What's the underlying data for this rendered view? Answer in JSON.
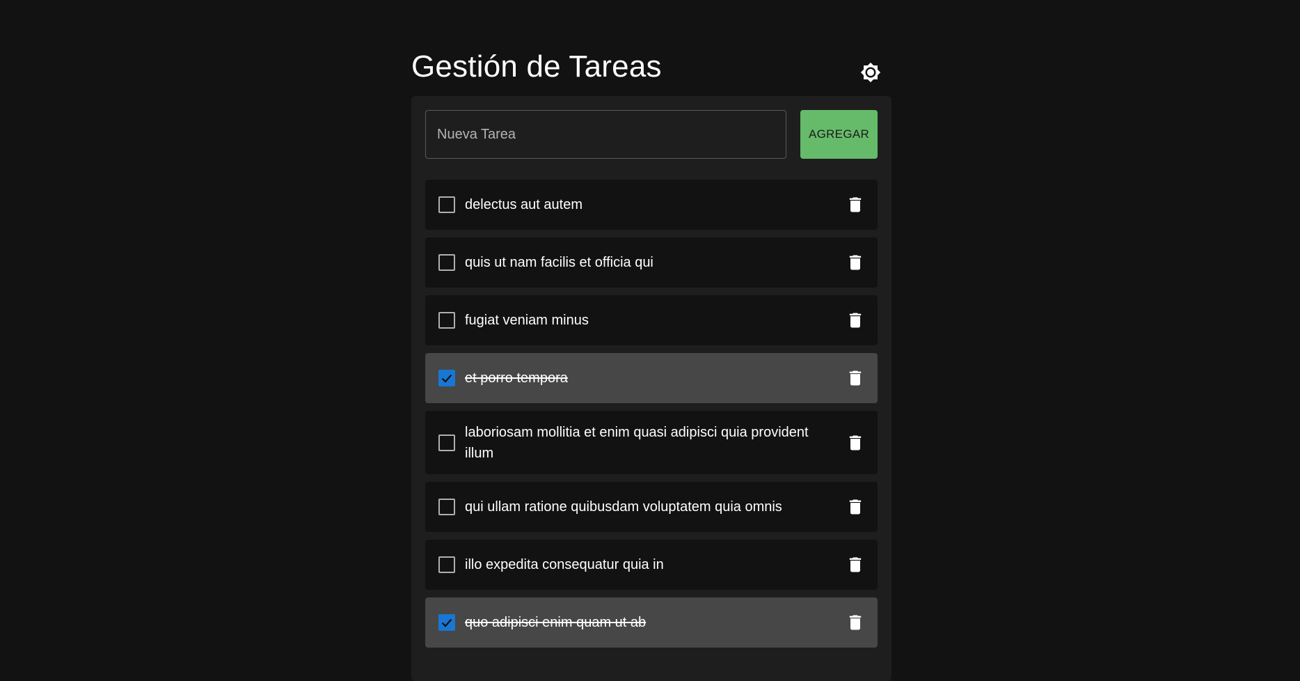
{
  "header": {
    "title": "Gestión de Tareas",
    "theme_icon": "brightness-icon"
  },
  "new_task": {
    "placeholder": "Nueva Tarea",
    "value": "",
    "add_label": "AGREGAR"
  },
  "colors": {
    "background": "#121212",
    "panel": "#1e1e1e",
    "task_item": "#121212",
    "task_item_done": "#474747",
    "accent_green": "#66bb6a",
    "checkbox_checked": "#1976d2"
  },
  "tasks": [
    {
      "text": "delectus aut autem",
      "completed": false
    },
    {
      "text": "quis ut nam facilis et officia qui",
      "completed": false
    },
    {
      "text": "fugiat veniam minus",
      "completed": false
    },
    {
      "text": "et porro tempora",
      "completed": true
    },
    {
      "text": "laboriosam mollitia et enim quasi adipisci quia provident illum",
      "completed": false
    },
    {
      "text": "qui ullam ratione quibusdam voluptatem quia omnis",
      "completed": false
    },
    {
      "text": "illo expedita consequatur quia in",
      "completed": false
    },
    {
      "text": "quo adipisci enim quam ut ab",
      "completed": true
    }
  ]
}
